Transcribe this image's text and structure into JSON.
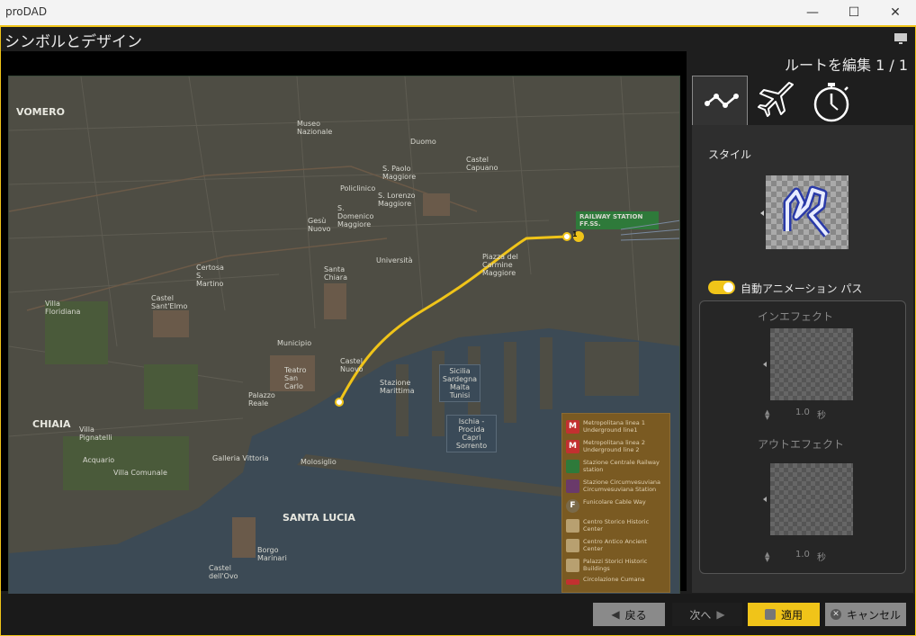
{
  "window": {
    "title": "proDAD",
    "minimize": "—",
    "maximize": "☐",
    "close": "✕"
  },
  "app": {
    "title": "シンボルとデザイン"
  },
  "route": {
    "label": "ルートを編集 1 / 1"
  },
  "tabs": [
    {
      "name": "path-tab",
      "icon": "route-line-icon"
    },
    {
      "name": "vehicle-tab",
      "icon": "airplane-icon"
    },
    {
      "name": "timing-tab",
      "icon": "stopwatch-icon"
    }
  ],
  "style": {
    "label": "スタイル"
  },
  "auto_animation": {
    "label": "自動アニメーション パス",
    "enabled": true
  },
  "in_effect": {
    "label": "インエフェクト",
    "value": "1.0",
    "unit": "秒"
  },
  "out_effect": {
    "label": "アウトエフェクト",
    "value": "1.0",
    "unit": "秒"
  },
  "map": {
    "waypoint_number": "1",
    "labels": {
      "vomero": "VOMERO",
      "museo": "Museo Nazionale",
      "duomo": "Duomo",
      "castel_capuano": "Castel Capuano",
      "railway": "RAILWAY STATION FF.SS.",
      "paolo": "S. Paolo Maggiore",
      "policlinico": "Policlinico",
      "lorenzo": "S. Lorenzo Maggiore",
      "domenico": "S. Domenico Maggiore",
      "gesu": "Gesù Nuovo",
      "chiara": "Santa Chiara",
      "universita": "Università",
      "carmine": "Piazza del Carmine Maggiore",
      "certosa": "Certosa S. Martino",
      "elmo": "Castel Sant'Elmo",
      "floridiana": "Villa Floridiana",
      "municipio": "Municipio",
      "castel_nuovo": "Castel Nuovo",
      "teatro": "Teatro San Carlo",
      "palazzo": "Palazzo Reale",
      "stazione": "Stazione Marittima",
      "sicilia": "Sicilia Sardegna Malta Tunisi",
      "ischia": "Ischia - Procida Capri Sorrento",
      "chiaia": "CHIAIA",
      "pignatelli": "Villa Pignatelli",
      "acquario": "Acquario",
      "villa_comunale": "Villa Comunale",
      "galleria": "Galleria Vittoria",
      "molosiglio": "Molosiglio",
      "santa_lucia": "SANTA LUCIA",
      "borgo": "Borgo Marinari",
      "castel_ovo": "Castel dell'Ovo"
    },
    "legend": [
      {
        "sym": "M",
        "text": "Metropolitana linea 1 Underground line1"
      },
      {
        "sym": "M",
        "text": "Metropolitana linea 2 Underground line 2"
      },
      {
        "sym": "",
        "text": "Stazione Centrale Railway station"
      },
      {
        "sym": "",
        "text": "Stazione Circumvesuviana Circumvesuviana Station"
      },
      {
        "sym": "F",
        "text": "Funicolare Cable Way"
      },
      {
        "sym": "",
        "text": "Centro Storico Historic Center"
      },
      {
        "sym": "",
        "text": "Centro Antico Ancient Center"
      },
      {
        "sym": "",
        "text": "Palazzi Storici Historic Buildings"
      },
      {
        "sym": "",
        "text": "Circolazione Cumana"
      }
    ]
  },
  "footer": {
    "back": "戻る",
    "next": "次へ",
    "apply": "適用",
    "cancel": "キャンセル"
  },
  "colors": {
    "accent": "#f0c419",
    "route": "#f0c419"
  }
}
